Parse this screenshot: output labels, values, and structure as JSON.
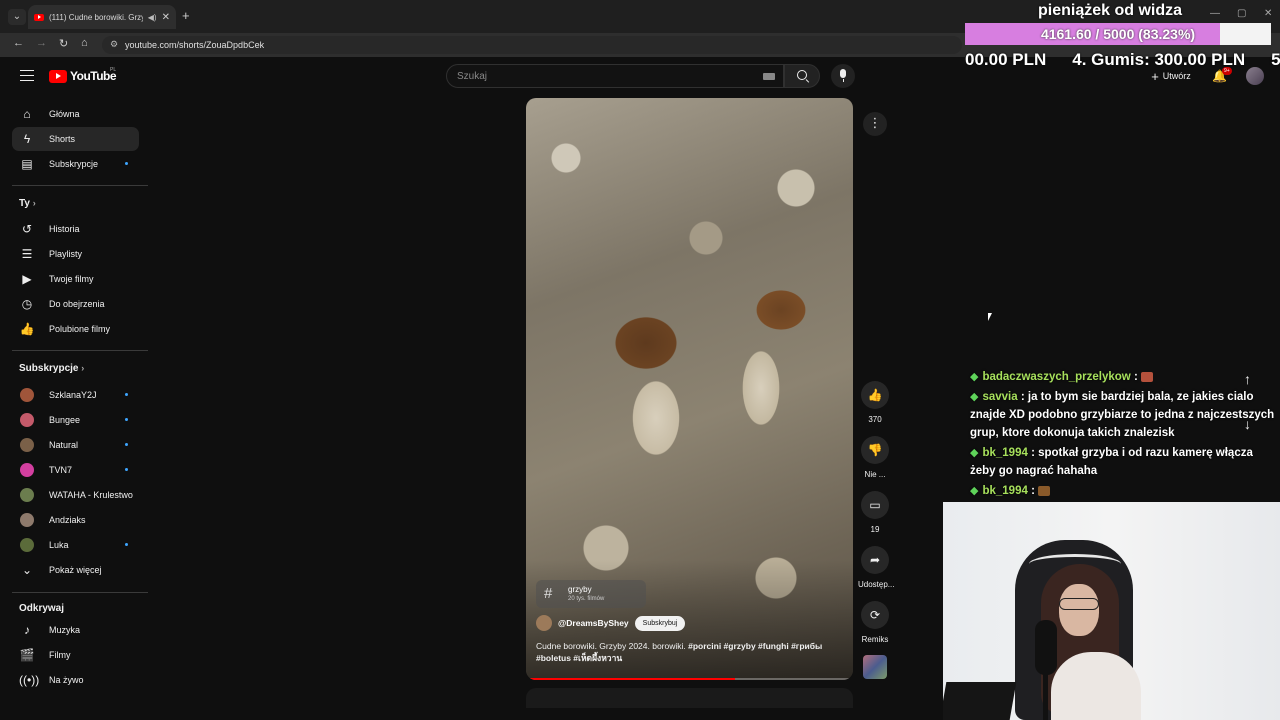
{
  "browser": {
    "tab_title": "(111) Cudne borowiki. Grzyby",
    "url": "youtube.com/shorts/ZouaDpdbCek"
  },
  "masthead": {
    "logo_text": "YouTube",
    "region": "PL",
    "search_placeholder": "Szukaj",
    "create_label": "Utwórz",
    "notification_count": "9+"
  },
  "sidebar": {
    "main": [
      {
        "label": "Główna",
        "icon": "home-icon",
        "active": false
      },
      {
        "label": "Shorts",
        "icon": "shorts-icon",
        "active": true
      },
      {
        "label": "Subskrypcje",
        "icon": "subscriptions-icon",
        "active": false
      }
    ],
    "you_header": "Ty",
    "you": [
      {
        "label": "Historia",
        "icon": "history-icon"
      },
      {
        "label": "Playlisty",
        "icon": "playlist-icon"
      },
      {
        "label": "Twoje filmy",
        "icon": "your-videos-icon"
      },
      {
        "label": "Do obejrzenia",
        "icon": "watch-later-icon"
      },
      {
        "label": "Polubione filmy",
        "icon": "liked-icon"
      }
    ],
    "subs_header": "Subskrypcje",
    "subscriptions": [
      {
        "label": "SzklanaY2J",
        "color": "#a0553a"
      },
      {
        "label": "Bungee",
        "color": "#c45a6a"
      },
      {
        "label": "Natural",
        "color": "#7a6048"
      },
      {
        "label": "TVN7",
        "color": "#d33fa0"
      },
      {
        "label": "WATAHA - Krulestwo",
        "color": "#6b7d4e"
      },
      {
        "label": "Andziaks",
        "color": "#8e7a6c"
      },
      {
        "label": "Luka",
        "color": "#5b6b3a"
      }
    ],
    "show_more": "Pokaż więcej",
    "explore_header": "Odkrywaj",
    "explore": [
      {
        "label": "Muzyka",
        "icon": "music-icon"
      },
      {
        "label": "Filmy",
        "icon": "movies-icon"
      },
      {
        "label": "Na żywo",
        "icon": "live-icon"
      }
    ]
  },
  "short": {
    "hashtag": "grzyby",
    "hashtag_count": "20 tys. filmów",
    "channel": "@DreamsByShey",
    "subscribe_label": "Subskrybuj",
    "title_plain": "Cudne borowiki. Grzyby 2024. borowiki. ",
    "title_tags": "#porcini #grzyby #funghi #грибы #boletus #เห็ดผึ้งหวาน",
    "progress": 0.64
  },
  "actions": {
    "likes": "370",
    "dislike_label": "Nie ...",
    "comments": "19",
    "share_label": "Udostęp...",
    "remix_label": "Remiks"
  },
  "overlay": {
    "donation_title": "pieniążek od widza",
    "donation_progress_text": "4161.60 / 5000 (83.23%)",
    "donation_progress": 0.8323,
    "ticker": [
      "00.00 PLN",
      "4. Gumis: 300.00 PLN",
      "5."
    ],
    "chat": [
      {
        "user": "badaczwaszych_przelykow",
        "text": ""
      },
      {
        "user": "savvia",
        "text": "ja to bym sie bardziej bala, ze jakies cialo znajde XD podobno grzybiarze to jedna z najczestszych grup, ktore dokonuja takich znalezisk"
      },
      {
        "user": "bk_1994",
        "text": "spotkał grzyba i od razu kamerę włącza żeby go nagrać hahaha"
      },
      {
        "user": "bk_1994",
        "text": ""
      }
    ]
  }
}
